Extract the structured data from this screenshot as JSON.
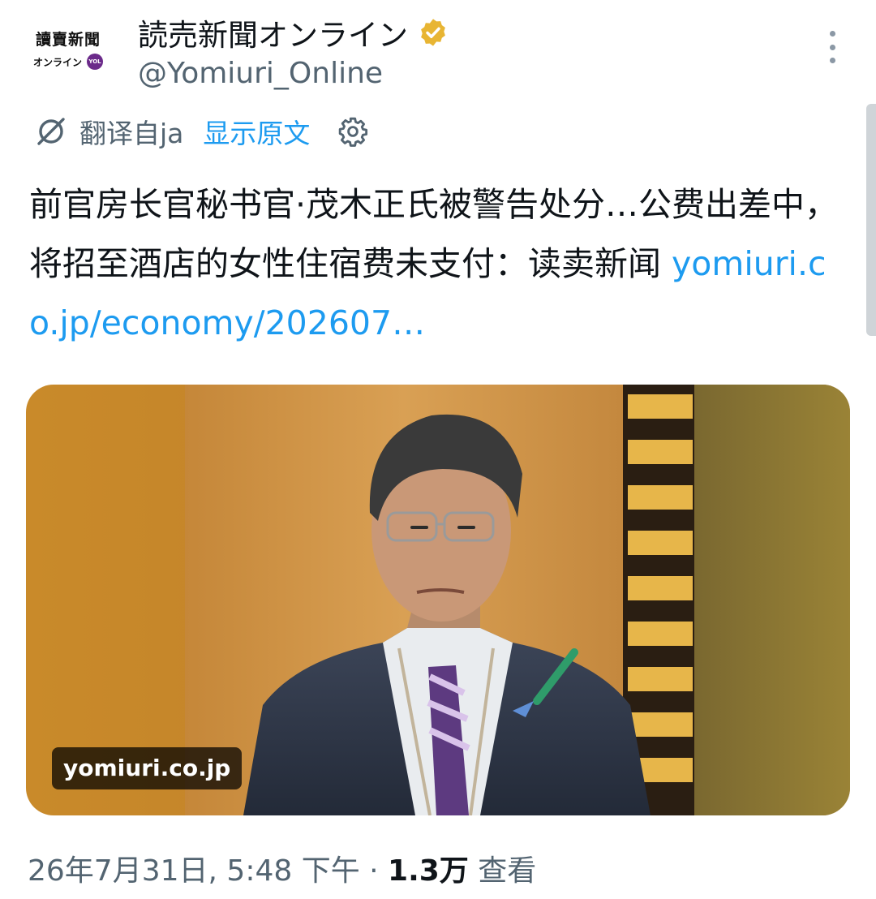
{
  "account": {
    "avatar_logo_text": "讀賣新聞",
    "avatar_logo_sub": "オンライン",
    "avatar_badge": "YOL",
    "display_name": "読売新聞オンライン",
    "handle": "@Yomiuri_Online",
    "verified_badge_color": "#e8b533"
  },
  "translation": {
    "translated_from": "翻译自ja",
    "show_original": "显示原文",
    "icon": "translate-icon",
    "settings_icon": "gear-icon"
  },
  "tweet": {
    "text": "前官房长官秘书官·茂木正氏被警告处分…公费出差中，将招至酒店的女性住宿费未支付：读卖新闻 ",
    "link_text": "yomiuri.co.jp/economy/202607…",
    "link_color": "#1d9bf0"
  },
  "media": {
    "source_label": "yomiuri.co.jp"
  },
  "meta": {
    "timestamp": "26年7月31日, 5:48 下午 · ",
    "views_count": "1.3万",
    "views_label": " 查看"
  }
}
